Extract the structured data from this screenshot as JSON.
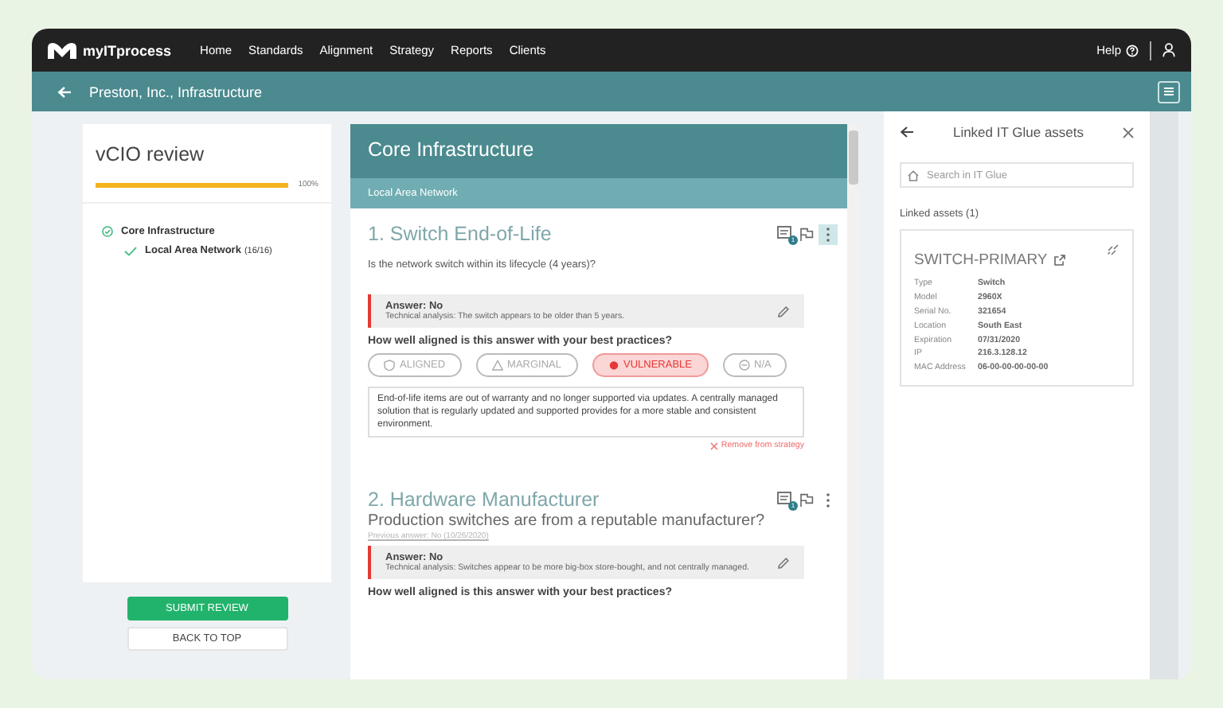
{
  "nav": {
    "brand": "myITprocess",
    "items": [
      {
        "label": "Home",
        "selected": false
      },
      {
        "label": "Standards",
        "selected": false
      },
      {
        "label": "Alignment",
        "selected": false
      },
      {
        "label": "Strategy",
        "selected": false
      },
      {
        "label": "Reports",
        "selected": false
      },
      {
        "label": "Clients",
        "selected": false
      }
    ],
    "help": "Help"
  },
  "header": {
    "title": "Preston, Inc., Infrastructure"
  },
  "review": {
    "title": "vCIO review",
    "progress": {
      "level": 1,
      "reading": "100%"
    },
    "tree": [
      {
        "label": "Core Infrastructure",
        "checked": true,
        "children": [
          {
            "label": "Local Area Network",
            "count": "(16/16)",
            "checked": true
          }
        ]
      }
    ],
    "buttons": [
      {
        "label": "SUBMIT REVIEW",
        "kind": "primary"
      },
      {
        "label": "BACK TO TOP",
        "kind": "secondary"
      }
    ]
  },
  "section": {
    "title": "Core Infrastructure",
    "subtitle": "Local Area Network",
    "questions": [
      {
        "title": "1. Switch End-of-Life",
        "kind": "detail",
        "question": "Is the network switch within its lifecycle (4 years)?",
        "notes_count": "1",
        "menu_selected": true,
        "answer": "Answer: No",
        "analysis": "Technical analysis: The switch appears to be older than 5 years.",
        "alignment_prompt": "How well aligned is this answer with your best practices?",
        "options": [
          {
            "label": "ALIGNED",
            "kind": "aligned",
            "selected": false
          },
          {
            "label": "MARGINAL",
            "kind": "marginal",
            "selected": false
          },
          {
            "label": "VULNERABLE",
            "kind": "vulnerable",
            "selected": true
          },
          {
            "label": "N/A",
            "kind": "na",
            "selected": false
          }
        ],
        "note": "End-of-life items are out of warranty and no longer supported via updates. A centrally managed solution that is regularly updated and supported provides for a more stable and consistent environment.",
        "remove": "Remove from strategy"
      },
      {
        "title": "2. Hardware Manufacturer",
        "kind": "headline",
        "question": "Production switches are from a reputable manufacturer?",
        "previous_answer": "Previous answer: No (10/26/2020)",
        "notes_count": "1",
        "menu_selected": false,
        "answer": "Answer: No",
        "analysis": "Technical analysis: Switches appear to be more big-box store-bought, and not centrally managed.",
        "alignment_prompt": "How well aligned is this answer with your best practices?"
      }
    ]
  },
  "assets": {
    "title": "Linked IT Glue assets",
    "search": {
      "placeholder": "Search in IT Glue"
    },
    "linked_label": "Linked assets (1)",
    "asset": {
      "name": "SWITCH-PRIMARY",
      "fields": [
        {
          "label": "Type",
          "value": "Switch"
        },
        {
          "label": "Model",
          "value": "2960X"
        },
        {
          "label": "Serial No.",
          "value": "321654"
        },
        {
          "label": "Location",
          "value": "South East"
        },
        {
          "label": "Expiration",
          "value": "07/31/2020"
        },
        {
          "label": "IP",
          "value": "216.3.128.12"
        },
        {
          "label": "MAC Address",
          "value": "06-00-00-00-00-00"
        }
      ]
    }
  }
}
